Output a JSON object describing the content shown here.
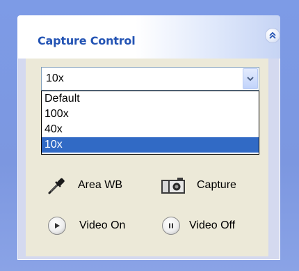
{
  "panel": {
    "title": "Capture Control",
    "collapse_icon": "double-chevron-up-icon"
  },
  "magnification": {
    "selected_value": "10x",
    "options": [
      "Default",
      "100x",
      "40x",
      "10x"
    ],
    "highlighted_option": "10x"
  },
  "actions": {
    "area_wb": {
      "label": "Area WB",
      "icon": "eyedropper-icon"
    },
    "capture": {
      "label": "Capture",
      "icon": "camera-icon"
    },
    "video_on": {
      "label": "Video On",
      "icon": "play-icon"
    },
    "video_off": {
      "label": "Video Off",
      "icon": "pause-icon"
    }
  },
  "colors": {
    "title_text": "#2454b4",
    "selection_highlight": "#316ac5",
    "page_background": "#7c97e0",
    "panel_body": "#ece9d8"
  }
}
